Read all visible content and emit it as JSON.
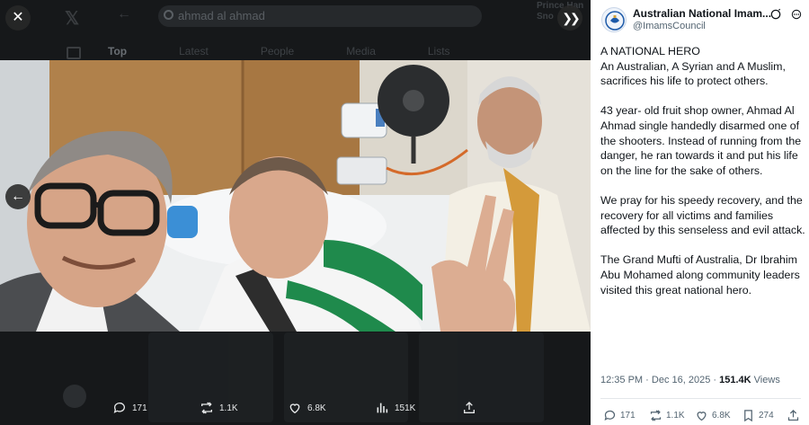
{
  "background_page": {
    "search_text": "ahmad al ahmad",
    "tabs": [
      "Top",
      "Latest",
      "People",
      "Media",
      "Lists"
    ],
    "right_snippet": "Prince Han\nSno"
  },
  "post": {
    "author": {
      "name": "Australian National Imam...",
      "handle": "@ImamsCouncil",
      "avatar_icon": "imams-council-logo-icon"
    },
    "paragraphs": [
      "A NATIONAL HERO\nAn Australian, A Syrian and A Muslim, sacrifices his life to protect others.",
      "43 year- old fruit shop owner, Ahmad Al Ahmad single handedly disarmed one of the shooters. Instead of running from the danger, he ran towards it and put his life on the line for the sake of others.",
      "We pray for his speedy recovery, and the recovery for all victims and families affected by this senseless and evil attack.",
      "The Grand Mufti of Australia, Dr Ibrahim Abu Mohamed along community leaders visited this great national hero."
    ],
    "time": "12:35 PM",
    "date": "Dec 16, 2025",
    "sep": "·",
    "views_count": "151.4K",
    "views_label": "Views",
    "actions": {
      "replies": "171",
      "reposts": "1.1K",
      "likes": "6.8K",
      "bookmarks": "274"
    }
  },
  "media_actions": {
    "replies": "171",
    "reposts": "1.1K",
    "likes": "6.8K",
    "views": "151K"
  },
  "colors": {
    "accent": "#1d9bf0",
    "panel_bg": "#ffffff",
    "text_primary": "#0f1419",
    "text_secondary": "#536471",
    "scarf_green": "#1f8a4c"
  }
}
